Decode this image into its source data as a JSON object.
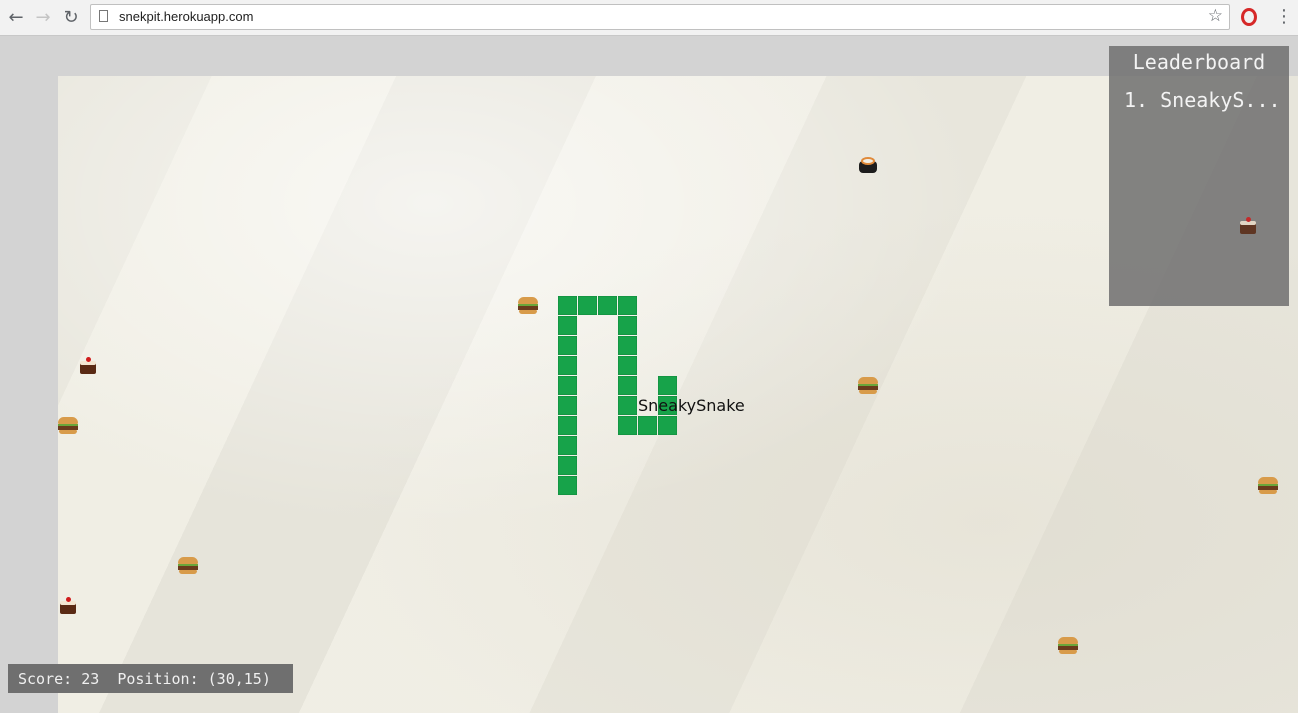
{
  "browser": {
    "url": "snekpit.herokuapp.com",
    "back_icon": "arrow-left-icon",
    "forward_icon": "arrow-right-icon",
    "reload_icon": "reload-icon",
    "bookmark_icon": "star-icon",
    "extension_icon": "opera-icon",
    "menu_icon": "kebab-menu-icon"
  },
  "game": {
    "player_name": "SneakySnake",
    "snake_color": "#17a34a",
    "food_items": [
      "burger",
      "burger",
      "burger",
      "burger",
      "burger",
      "burger",
      "cake",
      "cake",
      "cake",
      "sushi"
    ]
  },
  "leaderboard": {
    "title": "Leaderboard",
    "entries": [
      "1. SneakyS..."
    ]
  },
  "status": {
    "text": "Score: 23  Position: (30,15)"
  }
}
